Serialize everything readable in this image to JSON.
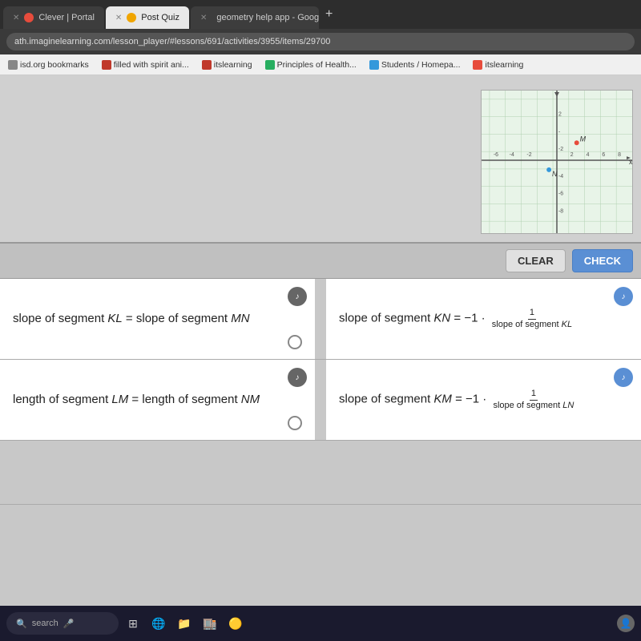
{
  "browser": {
    "tabs": [
      {
        "id": "tab-clever",
        "label": "Clever | Portal",
        "icon_color": "#e74c3c",
        "active": false
      },
      {
        "id": "tab-quiz",
        "label": "Post Quiz",
        "icon_color": "#f0a500",
        "active": true
      },
      {
        "id": "tab-geometry",
        "label": "geometry help app - Google Sea...",
        "icon_color": "#4285f4",
        "active": false
      }
    ],
    "address": "ath.imaginelearning.com/lesson_player/#lessons/691/activities/3955/items/29700",
    "new_tab_label": "+"
  },
  "bookmarks": [
    {
      "id": "bm-isd",
      "label": "isd.org bookmarks",
      "icon_color": "#888"
    },
    {
      "id": "bm-spirit",
      "label": "filled with spirit ani...",
      "icon_color": "#c0392b"
    },
    {
      "id": "bm-its1",
      "label": "itslearning",
      "icon_color": "#c0392b"
    },
    {
      "id": "bm-principles",
      "label": "Principles of Health...",
      "icon_color": "#27ae60"
    },
    {
      "id": "bm-students",
      "label": "Students / Homepa...",
      "icon_color": "#3498db"
    },
    {
      "id": "bm-its2",
      "label": "itslearning",
      "icon_color": "#e74c3c"
    }
  ],
  "buttons": {
    "clear_label": "CLEAR",
    "check_label": "CHECK"
  },
  "answers": [
    {
      "id": "ans-1",
      "left": {
        "text": "slope of segment KL = slope of segment MN",
        "has_audio": true
      },
      "right": {
        "text": "slope of segment KN = −1 · (1 / slope of segment KL)",
        "has_audio": true,
        "has_radio": false
      },
      "radio": false
    },
    {
      "id": "ans-2",
      "left": {
        "text": "length of segment LM = length of segment NM",
        "has_audio": true
      },
      "right": {
        "text": "slope of segment KM = −1 · (1 / slope of segment LN)",
        "has_audio": true,
        "has_radio": false
      },
      "radio": false
    }
  ],
  "graph": {
    "title": "Coordinate graph with points M and N",
    "point_m": "M",
    "point_n": "N",
    "x_range": [
      -8,
      8
    ],
    "y_range": [
      -8,
      8
    ]
  },
  "taskbar": {
    "search_placeholder": "search",
    "icons": [
      "⊞",
      "🌐",
      "📁",
      "⊞",
      "🔵"
    ]
  }
}
